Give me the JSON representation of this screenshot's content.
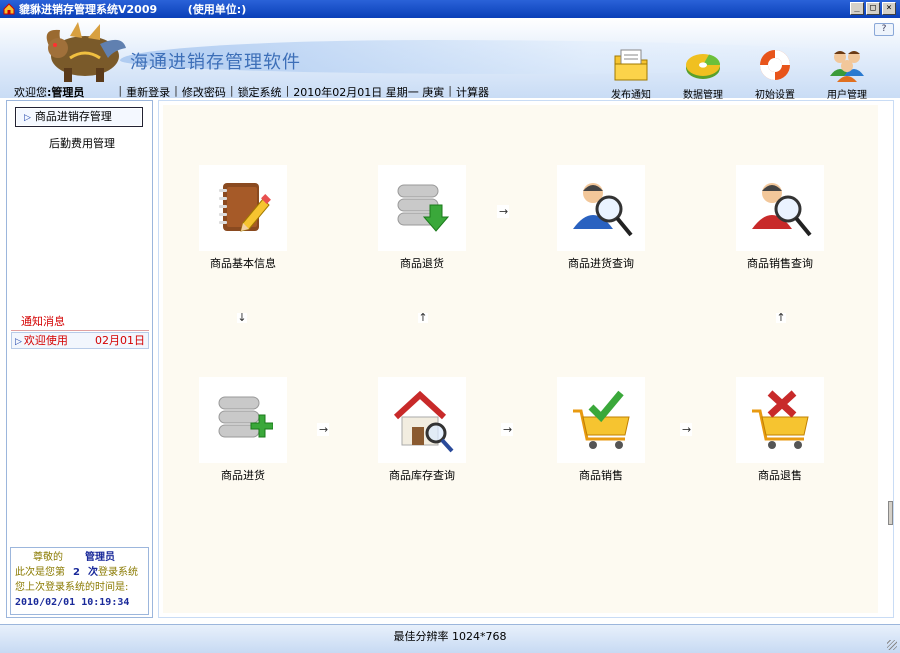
{
  "window": {
    "title": "貔貅进销存管理系统V2009        (使用单位:)",
    "controls": [
      "_",
      "□",
      "×"
    ]
  },
  "header": {
    "software_title": "海通进销存管理软件",
    "help": "?",
    "welcome": "欢迎您",
    "user": ":管理员",
    "links": [
      "重新登录",
      "修改密码",
      "锁定系统"
    ],
    "date": "2010年02月01日  星期一  庚寅",
    "calculator": "计算器",
    "toolbar": [
      {
        "label": "发布通知",
        "icon": "notice-folder-icon"
      },
      {
        "label": "数据管理",
        "icon": "data-disk-icon"
      },
      {
        "label": "初始设置",
        "icon": "lifebuoy-icon"
      },
      {
        "label": "用户管理",
        "icon": "users-icon"
      }
    ]
  },
  "sidebar": {
    "menu": [
      "商品进销存管理",
      "后勤费用管理"
    ],
    "notice_title": "通知消息",
    "notice": {
      "text": "欢迎使用",
      "date": "02月01日"
    },
    "login": {
      "greet_prefix": "尊敬的",
      "user": "管理员",
      "count_prefix": "此次是您第",
      "count": "2",
      "count_suffix_bold": "次",
      "count_suffix": "登录系统",
      "last_label": "您上次登录系统的时间是:",
      "last_time": "2010/02/01  10:19:34"
    }
  },
  "flow": {
    "nodes": [
      {
        "label": "商品基本信息",
        "icon": "notebook-pencil-icon"
      },
      {
        "label": "商品退货",
        "icon": "database-download-icon"
      },
      {
        "label": "商品进货查询",
        "icon": "user-search-blue-icon"
      },
      {
        "label": "商品销售查询",
        "icon": "user-search-red-icon"
      },
      {
        "label": "商品进货",
        "icon": "database-add-icon"
      },
      {
        "label": "商品库存查询",
        "icon": "house-search-icon"
      },
      {
        "label": "商品销售",
        "icon": "cart-check-icon"
      },
      {
        "label": "商品退售",
        "icon": "cart-cross-icon"
      }
    ],
    "arrow_right": "→",
    "arrow_up": "↑",
    "arrow_down": "↓"
  },
  "status": {
    "text": "最佳分辨率 1024*768"
  },
  "colors": {
    "title_bar": "#0a3fb8",
    "notice_red": "#d40000",
    "panel_bg": "#fdfaf1",
    "accent_blue": "#3d6fb8"
  }
}
